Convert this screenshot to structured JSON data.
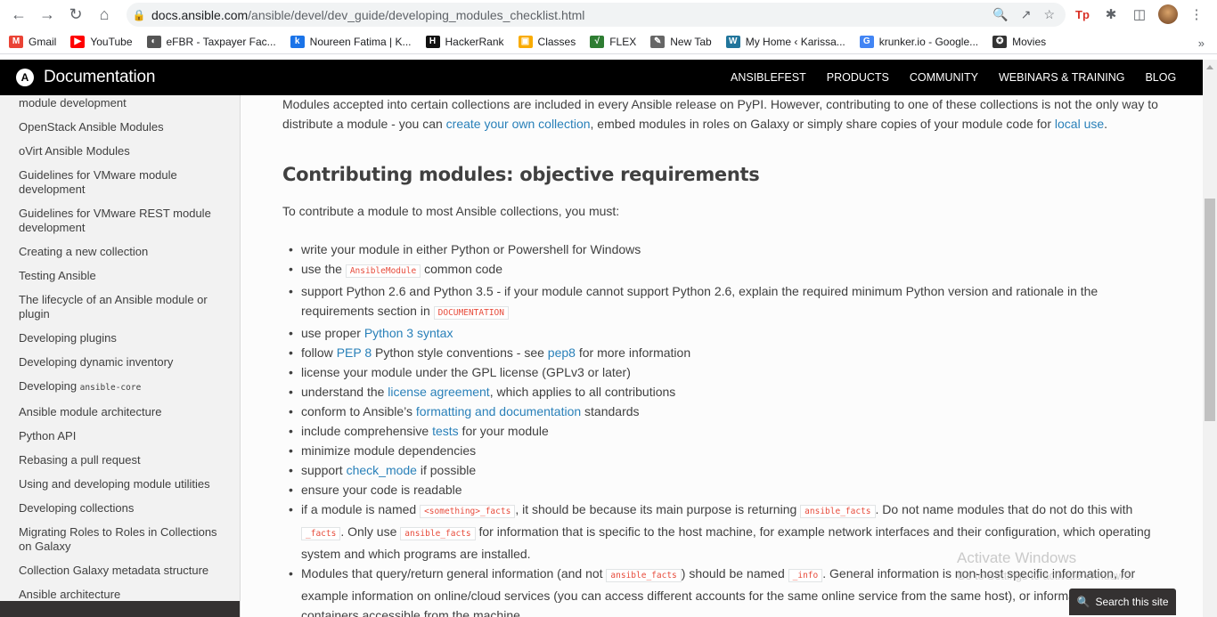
{
  "browser": {
    "url_domain": "docs.ansible.com",
    "url_path": "/ansible/devel/dev_guide/developing_modules_checklist.html",
    "bookmarks": [
      {
        "label": "Gmail",
        "icon": "gmail-icon",
        "color": "#ea4335",
        "glyph": "M"
      },
      {
        "label": "YouTube",
        "icon": "youtube-icon",
        "color": "#ff0000",
        "glyph": "▶"
      },
      {
        "label": "eFBR - Taxpayer Fac...",
        "icon": "globe-icon",
        "color": "#555555",
        "glyph": "◐"
      },
      {
        "label": "Noureen Fatima | K...",
        "icon": "k-icon",
        "color": "#1a73e8",
        "glyph": "k"
      },
      {
        "label": "HackerRank",
        "icon": "hackerrank-icon",
        "color": "#111111",
        "glyph": "H"
      },
      {
        "label": "Classes",
        "icon": "classroom-icon",
        "color": "#f9ab00",
        "glyph": "▣"
      },
      {
        "label": "FLEX",
        "icon": "flex-icon",
        "color": "#2e7d32",
        "glyph": "√"
      },
      {
        "label": "New Tab",
        "icon": "newtab-icon",
        "color": "#666666",
        "glyph": "✎"
      },
      {
        "label": "My Home ‹ Karissa...",
        "icon": "wordpress-icon",
        "color": "#21759b",
        "glyph": "W"
      },
      {
        "label": "krunker.io - Google...",
        "icon": "google-icon",
        "color": "#4285f4",
        "glyph": "G"
      },
      {
        "label": "Movies",
        "icon": "movies-icon",
        "color": "#333333",
        "glyph": "✪"
      }
    ]
  },
  "header": {
    "brand": "Documentation",
    "nav": [
      "ANSIBLEFEST",
      "PRODUCTS",
      "COMMUNITY",
      "WEBINARS & TRAINING",
      "BLOG"
    ]
  },
  "sidebar": {
    "items": [
      {
        "label": "module development"
      },
      {
        "label": "OpenStack Ansible Modules"
      },
      {
        "label": "oVirt Ansible Modules"
      },
      {
        "label": "Guidelines for VMware module development"
      },
      {
        "label": "Guidelines for VMware REST module development"
      },
      {
        "label": "Creating a new collection"
      },
      {
        "label": "Testing Ansible"
      },
      {
        "label": "The lifecycle of an Ansible module or plugin"
      },
      {
        "label": "Developing plugins"
      },
      {
        "label": "Developing dynamic inventory"
      },
      {
        "label": "Developing ",
        "code": "ansible-core"
      },
      {
        "label": "Ansible module architecture"
      },
      {
        "label": "Python API"
      },
      {
        "label": "Rebasing a pull request"
      },
      {
        "label": "Using and developing module utilities"
      },
      {
        "label": "Developing collections"
      },
      {
        "label": "Migrating Roles to Roles in Collections on Galaxy"
      },
      {
        "label": "Collection Galaxy metadata structure"
      },
      {
        "label": "Ansible architecture"
      }
    ]
  },
  "main": {
    "intro_p1": "Modules accepted into certain collections are included in every Ansible release on PyPI. However, contributing to one of these collections is not the only way to distribute a module - you can ",
    "intro_link1": "create your own collection",
    "intro_p2": ", embed modules in roles on Galaxy or simply share copies of your module code for ",
    "intro_link2": "local use",
    "intro_p3": ".",
    "heading": "Contributing modules: objective requirements",
    "lead": "To contribute a module to most Ansible collections, you must:",
    "li1": "write your module in either Python or Powershell for Windows",
    "li2a": "use the ",
    "li2_code": "AnsibleModule",
    "li2b": " common code",
    "li3a": "support Python 2.6 and Python 3.5 - if your module cannot support Python 2.6, explain the required minimum Python version and rationale in the requirements section in ",
    "li3_code": "DOCUMENTATION",
    "li4a": "use proper ",
    "li4_link": "Python 3 syntax",
    "li5a": "follow ",
    "li5_link1": "PEP 8",
    "li5b": " Python style conventions - see ",
    "li5_link2": "pep8",
    "li5c": " for more information",
    "li6": "license your module under the GPL license (GPLv3 or later)",
    "li7a": "understand the ",
    "li7_link": "license agreement",
    "li7b": ", which applies to all contributions",
    "li8a": "conform to Ansible’s ",
    "li8_link": "formatting and documentation",
    "li8b": " standards",
    "li9a": "include comprehensive ",
    "li9_link": "tests",
    "li9b": " for your module",
    "li10": "minimize module dependencies",
    "li11a": "support ",
    "li11_link": "check_mode",
    "li11b": " if possible",
    "li12": "ensure your code is readable",
    "li13a": "if a module is named ",
    "li13_code1": "<something>_facts",
    "li13b": ", it should be because its main purpose is returning ",
    "li13_code2": "ansible_facts",
    "li13c": ". Do not name modules that do not do this with ",
    "li13_code3": "_facts",
    "li13d": ". Only use ",
    "li13_code4": "ansible_facts",
    "li13e": " for information that is specific to the host machine, for example network interfaces and their configuration, which operating system and which programs are installed.",
    "li14a": "Modules that query/return general information (and not ",
    "li14_code1": "ansible_facts",
    "li14b": ") should be named ",
    "li14_code2": "_info",
    "li14c": ". General information is non-host specific information, for example information on online/cloud services (you can access different accounts for the same online service from the same host), or information on VMs and containers accessible from the machine."
  },
  "overlay": {
    "watermark_title": "Activate Windows",
    "watermark_sub": "Go to Settings to activate Windows.",
    "search_label": "Search this site"
  }
}
